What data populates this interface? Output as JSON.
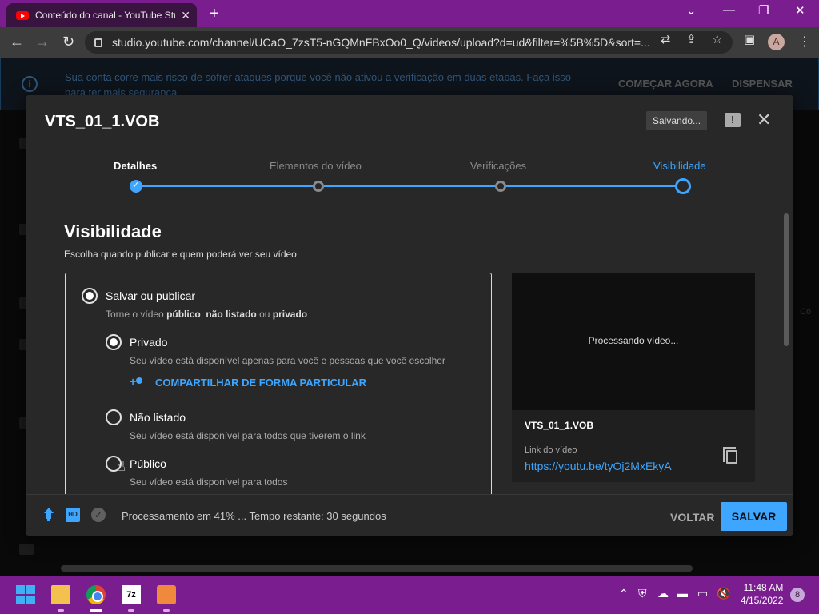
{
  "browser": {
    "tab_title": "Conteúdo do canal - YouTube Studio",
    "url": "studio.youtube.com/channel/UCaO_7zsT5-nGQMnFBxOo0_Q/videos/upload?d=ud&filter=%5B%5D&sort=...",
    "avatar_letter": "A"
  },
  "banner": {
    "message": "Sua conta corre mais risco de sofrer ataques porque você não ativou a verificação em duas etapas. Faça isso para ter mais segurança",
    "action_primary": "COMEÇAR AGORA",
    "action_secondary": "DISPENSAR"
  },
  "page_stub_text": "Co",
  "dialog": {
    "title": "VTS_01_1.VOB",
    "status_chip": "Salvando...",
    "steps": [
      {
        "label": "Detalhes",
        "state": "done"
      },
      {
        "label": "Elementos do vídeo",
        "state": "pending"
      },
      {
        "label": "Verificações",
        "state": "pending"
      },
      {
        "label": "Visibilidade",
        "state": "current"
      }
    ],
    "section_title": "Visibilidade",
    "section_subtitle": "Escolha quando publicar e quem poderá ver seu vídeo",
    "save_publish": {
      "label": "Salvar ou publicar",
      "desc_prefix": "Torne o vídeo ",
      "desc_public": "público",
      "desc_sep1": ", ",
      "desc_unlisted": "não listado",
      "desc_sep2": " ou ",
      "desc_private": "privado"
    },
    "options": [
      {
        "label": "Privado",
        "desc": "Seu vídeo está disponível apenas para você e pessoas que você escolher",
        "selected": true
      },
      {
        "label": "Não listado",
        "desc": "Seu vídeo está disponível para todos que tiverem o link",
        "selected": false
      },
      {
        "label": "Público",
        "desc": "Seu vídeo está disponível para todos",
        "selected": false
      }
    ],
    "share_privately": "COMPARTILHAR DE FORMA PARTICULAR",
    "preview": {
      "status": "Processando vídeo...",
      "filename": "VTS_01_1.VOB",
      "link_label": "Link do vídeo",
      "link": "https://youtu.be/tyOj2MxEkyA"
    },
    "footer": {
      "hd_badge": "HD",
      "progress_text": "Processamento em 41% ... Tempo restante: 30 segundos",
      "progress_percent": 41,
      "back_label": "VOLTAR",
      "save_label": "SALVAR"
    }
  },
  "taskbar": {
    "time": "11:48 AM",
    "date": "4/15/2022",
    "notification_count": "8",
    "zip_label": "7z"
  },
  "colors": {
    "accent_blue": "#3ea6ff",
    "chrome_frame": "#7a1d8f",
    "dialog_bg": "#282828"
  }
}
